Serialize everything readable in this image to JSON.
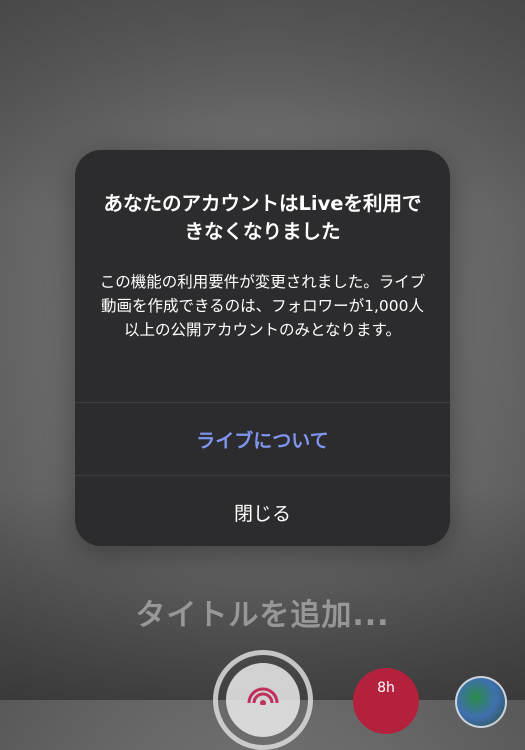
{
  "dialog": {
    "title": "あなたのアカウントはLiveを利用できなくなりました",
    "message": "この機能の利用要件が変更されました。ライブ動画を作成できるのは、フォロワーが1,000人以上の公開アカウントのみとなります。",
    "primary_action": "ライブについて",
    "close_action": "閉じる"
  },
  "background": {
    "title_placeholder": "タイトルを追加...",
    "effect_button_label": "8h"
  },
  "colors": {
    "dialog_bg": "#2c2c2e",
    "primary_action": "#7e96f0",
    "record_ring": "#e0e0e0",
    "effect_button": "#b3213c"
  },
  "icons": {
    "record": "live-record-icon",
    "effect": "effect-icon",
    "gallery": "gallery-thumbnail"
  }
}
